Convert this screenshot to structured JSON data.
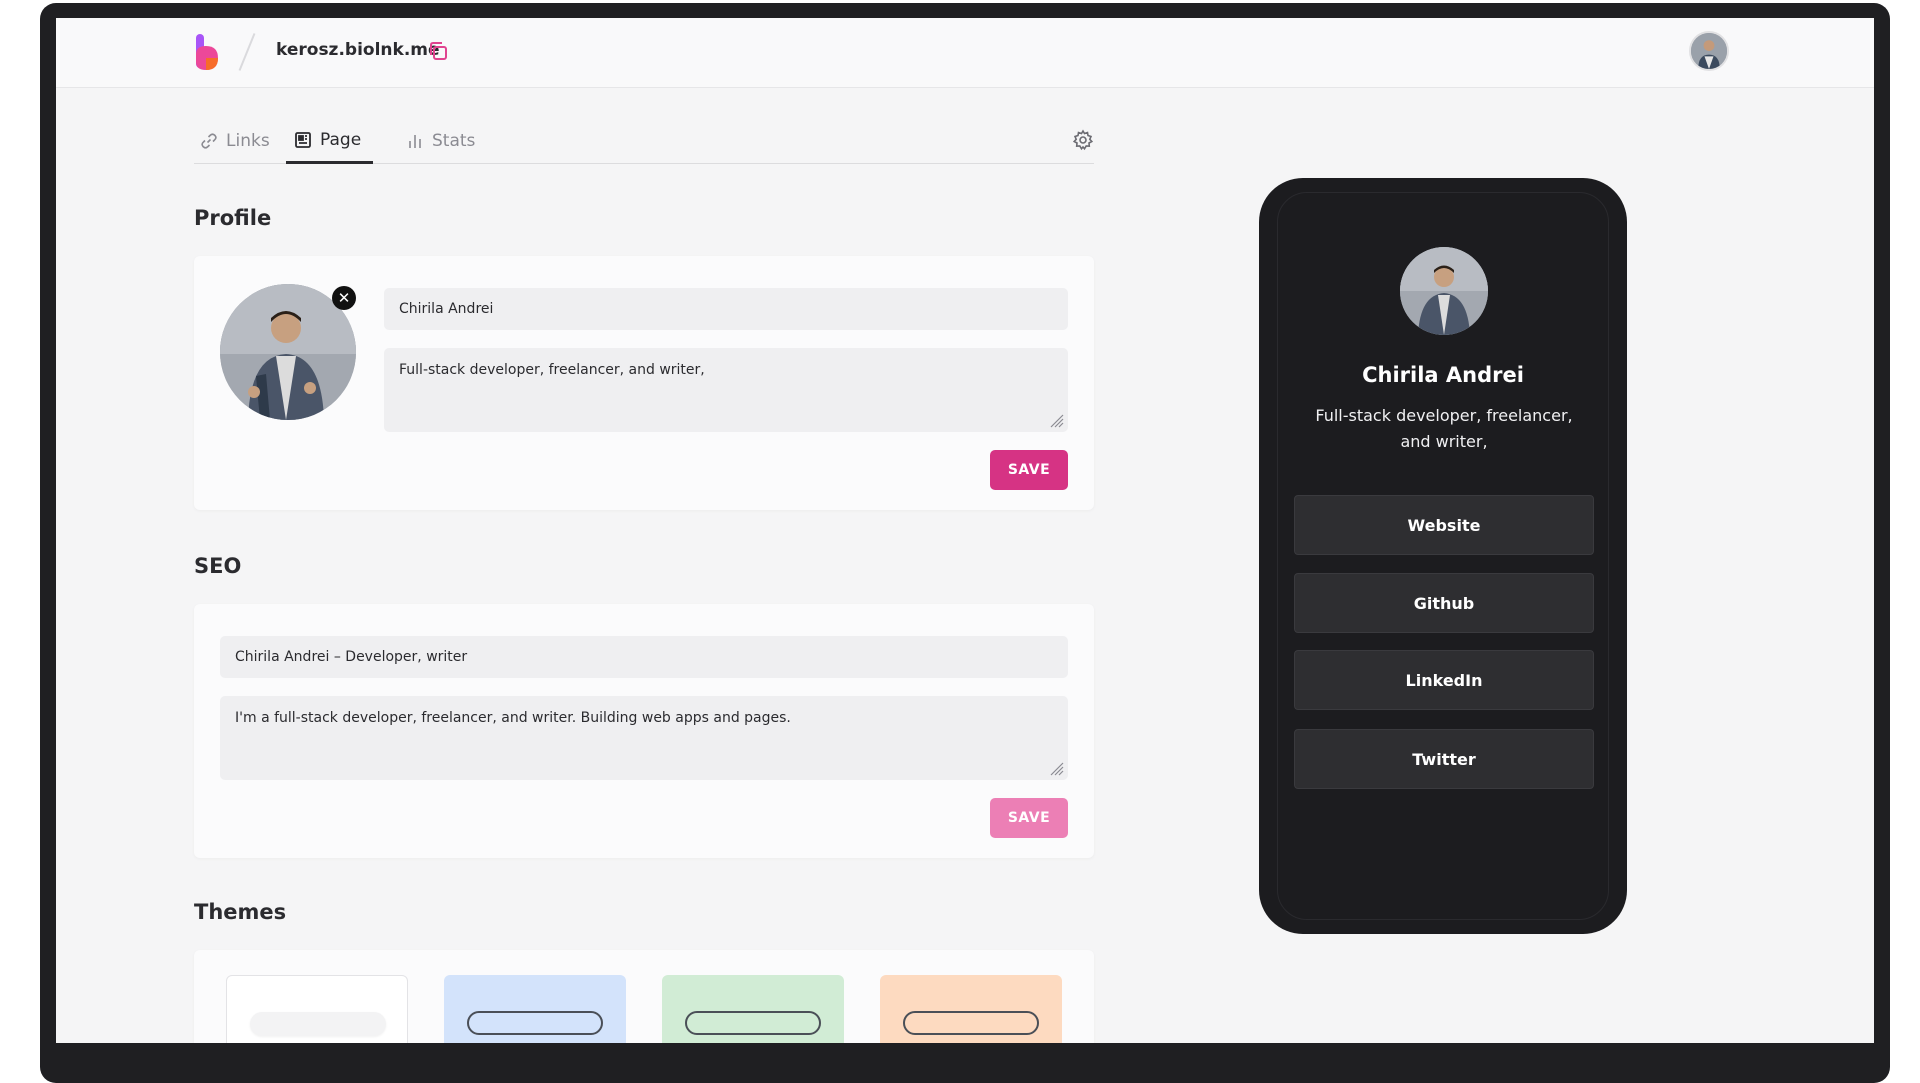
{
  "header": {
    "site_url": "kerosz.biolnk.me",
    "logo_colors": [
      "#a855f7",
      "#ec4899",
      "#f97316"
    ]
  },
  "tabs": [
    {
      "label": "Links",
      "icon": "link-icon",
      "active": false
    },
    {
      "label": "Page",
      "icon": "layout-icon",
      "active": true
    },
    {
      "label": "Stats",
      "icon": "bar-chart-icon",
      "active": false
    }
  ],
  "profile": {
    "section_title": "Profile",
    "name_value": "Chirila Andrei",
    "bio_value": "Full-stack developer, freelancer, and writer,",
    "save_label": "SAVE",
    "remove_symbol": "✕"
  },
  "seo": {
    "section_title": "SEO",
    "title_value": "Chirila Andrei – Developer, writer",
    "description_value": "I'm a full-stack developer, freelancer, and writer. Building web apps and pages.",
    "save_label": "SAVE"
  },
  "themes": {
    "section_title": "Themes",
    "items": [
      {
        "name": "light",
        "bg": "#ffffff",
        "pill": "#f3f3f4"
      },
      {
        "name": "blue",
        "bg": "#d3e3fb",
        "pill": "#d3e3fb"
      },
      {
        "name": "green",
        "bg": "#d1ecd5",
        "pill": "#d1ecd5"
      },
      {
        "name": "peach",
        "bg": "#fddac0",
        "pill": "#fddac0"
      }
    ]
  },
  "preview": {
    "name": "Chirila Andrei",
    "bio": "Full-stack developer, freelancer, and writer,",
    "links": [
      "Website",
      "Github",
      "LinkedIn",
      "Twitter"
    ]
  },
  "colors": {
    "accent": "#d63384",
    "accent_disabled": "#ec7fb5"
  }
}
